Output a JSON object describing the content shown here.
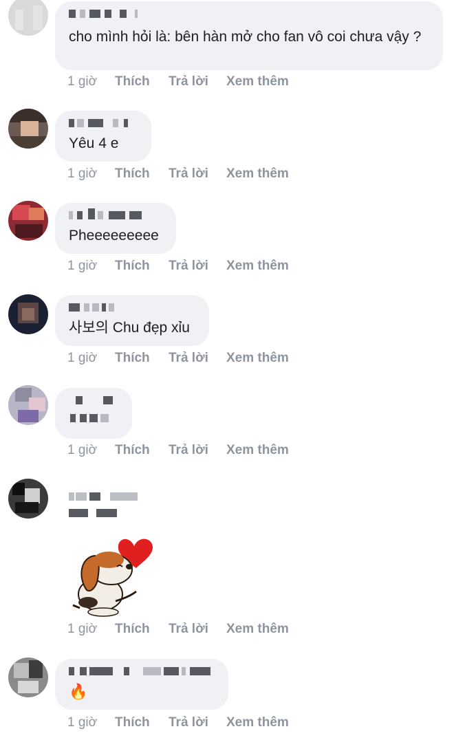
{
  "comments": [
    {
      "text": "cho mình hỏi là: bên hàn mở cho fan vô coi chưa vậy ?",
      "time": "1 giờ",
      "like": "Thích",
      "reply": "Trả lời",
      "more": "Xem thêm"
    },
    {
      "text": "Yêu 4 e",
      "time": "1 giờ",
      "like": "Thích",
      "reply": "Trả lời",
      "more": "Xem thêm"
    },
    {
      "text": "Pheeeeeeeee",
      "time": "1 giờ",
      "like": "Thích",
      "reply": "Trả lời",
      "more": "Xem thêm"
    },
    {
      "text": "사보의 Chu đẹp xỉu",
      "time": "1 giờ",
      "like": "Thích",
      "reply": "Trả lời",
      "more": "Xem thêm"
    },
    {
      "text": "",
      "time": "1 giờ",
      "like": "Thích",
      "reply": "Trả lời",
      "more": "Xem thêm"
    },
    {
      "text": "",
      "sticker": "puppy-heart-sticker",
      "time": "1 giờ",
      "like": "Thích",
      "reply": "Trả lời",
      "more": "Xem thêm"
    },
    {
      "text": "🔥",
      "time": "1 giờ",
      "like": "Thích",
      "reply": "Trả lời",
      "more": "Xem thêm"
    }
  ],
  "colors": {
    "bubble": "#f0f1f4",
    "action_text": "#8d949e",
    "text": "#1c1e21"
  }
}
